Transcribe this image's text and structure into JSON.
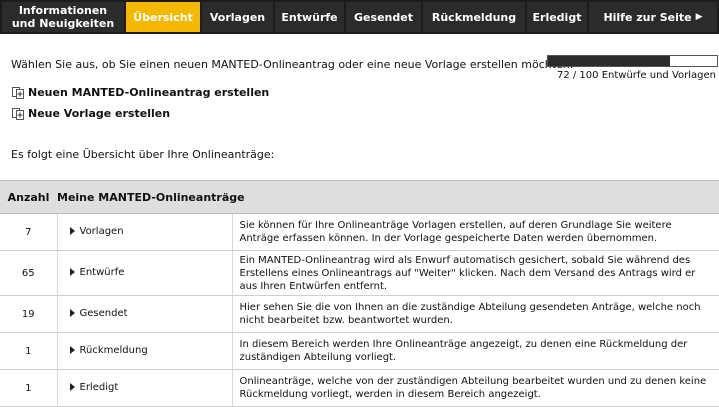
{
  "nav": {
    "tabs": [
      {
        "label_line1": "Informationen",
        "label_line2": "und Neuigkeiten"
      },
      {
        "label": "Übersicht"
      },
      {
        "label": "Vorlagen"
      },
      {
        "label": "Entwürfe"
      },
      {
        "label": "Gesendet"
      },
      {
        "label": "Rückmeldung"
      },
      {
        "label": "Erledigt"
      },
      {
        "label": "Hilfe zur Seite"
      }
    ],
    "active_color": "#f5b800",
    "tab_color": "#2b2b2b",
    "help_icon": "arrow-right-icon"
  },
  "intro": {
    "text": "Wählen Sie aus, ob Sie einen neuen MANTED-Onlineantrag oder eine neue Vorlage erstellen möchten:"
  },
  "progress": {
    "value": 72,
    "max": 100,
    "text": "72 / 100 Entwürfe und Vorlagen"
  },
  "actions": {
    "new_application": "Neuen MANTED-Onlineantrag erstellen",
    "new_template": "Neue Vorlage erstellen",
    "icon": "document-add-icon"
  },
  "summary": {
    "text": "Es folgt eine Übersicht über Ihre Onlineanträge:"
  },
  "table": {
    "headers": {
      "count": "Anzahl",
      "category": "Meine MANTED-Onlineanträge"
    },
    "rows": [
      {
        "count": "7",
        "category": "Vorlagen",
        "description": "Sie können für Ihre Onlineanträge Vorlagen erstellen, auf deren Grundlage Sie weitere Anträge erfassen können. In der Vorlage gespeicherte Daten werden übernommen."
      },
      {
        "count": "65",
        "category": "Entwürfe",
        "description": "Ein MANTED-Onlineantrag wird als Enwurf automatisch gesichert, sobald Sie während des Erstellens eines Onlineantrags auf \"Weiter\" klicken. Nach dem Versand des Antrags wird er aus Ihren Entwürfen entfernt."
      },
      {
        "count": "19",
        "category": "Gesendet",
        "description": "Hier sehen Sie die von Ihnen an die zuständige Abteilung gesendeten Anträge, welche noch nicht bearbeitet bzw. beantwortet wurden."
      },
      {
        "count": "1",
        "category": "Rückmeldung",
        "description": "In diesem Bereich werden Ihre Onlineanträge angezeigt, zu denen eine Rückmeldung der zuständigen Abteilung vorliegt."
      },
      {
        "count": "1",
        "category": "Erledigt",
        "description": "Onlineanträge, welche von der zuständigen Abteilung bearbeitet wurden und zu denen keine Rückmeldung vorliegt, werden in diesem Bereich angezeigt."
      }
    ]
  }
}
